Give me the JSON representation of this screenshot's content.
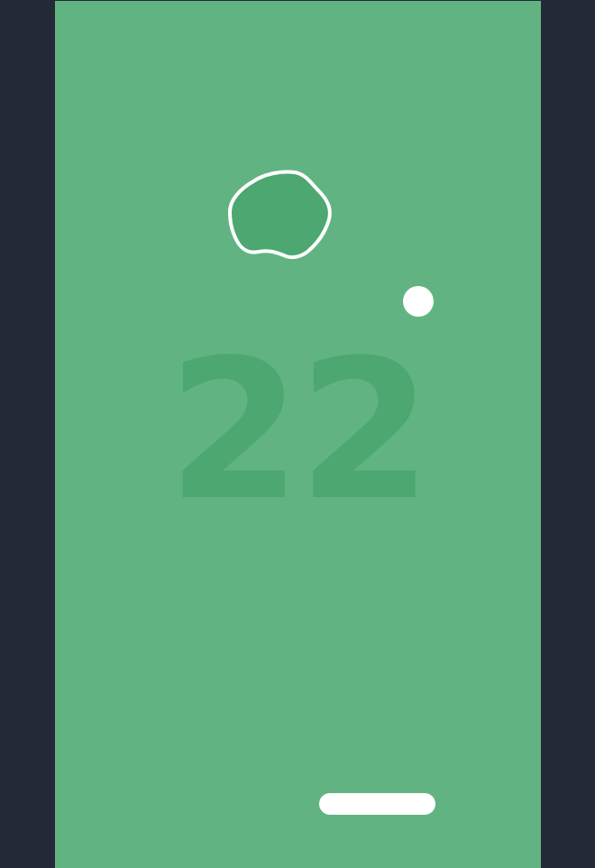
{
  "game": {
    "score": "22",
    "colors": {
      "background": "#232936",
      "field": "#61b482",
      "score_text": "#4da770",
      "blob_fill": "#4da770",
      "blob_outline": "#ffffff",
      "ball": "#ffffff",
      "paddle": "#ffffff"
    }
  }
}
